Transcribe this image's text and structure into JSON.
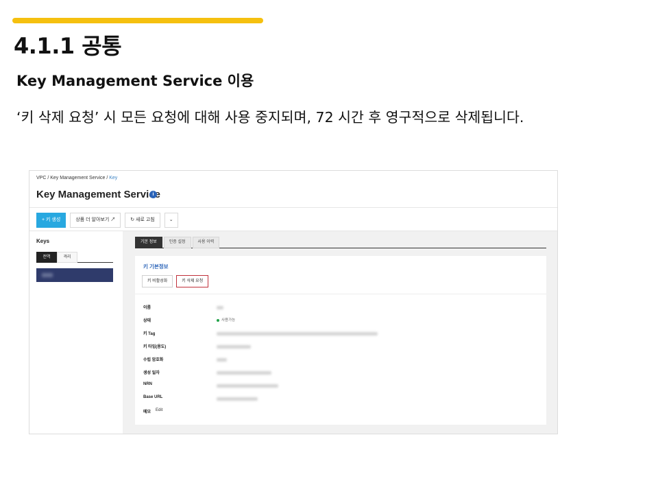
{
  "slide": {
    "title": "4.1.1 공통",
    "subtitle": "Key Management Service 이용",
    "description": "‘키 삭제 요청’ 시 모든 요청에 대해 사용 중지되며, 72 시간 후 영구적으로 삭제됩니다.",
    "accent_color": "#f5c00f"
  },
  "console": {
    "breadcrumb": {
      "root": "VPC",
      "service": "Key Management Service",
      "current": "Key"
    },
    "service_title": "Key Management Service",
    "info_icon": "info-icon",
    "toolbar": {
      "create_label": "+ 키 생성",
      "learn_more_label": "상품 더 알아보기 ↗",
      "refresh_label": "↻ 새로 고침",
      "more_icon": "chevron-down-icon",
      "more_glyph": "⌄"
    },
    "sidebar": {
      "title": "Keys",
      "tabs": [
        "전역",
        "격리"
      ],
      "active_tab": "전역"
    },
    "tabs": [
      "기본 정보",
      "인증 설정",
      "사용 이력"
    ],
    "active_tab": "기본 정보",
    "card": {
      "title": "키 기본정보",
      "disable_label": "키 비활성화",
      "delete_request_label": "키 삭제 요청",
      "highlight_color": "#c0303a",
      "rows": [
        {
          "label": "이름"
        },
        {
          "label": "상태",
          "status": "사용가능"
        },
        {
          "label": "키 Tag"
        },
        {
          "label": "키 타입(용도)"
        },
        {
          "label": "수립 암호화"
        },
        {
          "label": "생성 일자"
        },
        {
          "label": "NRN"
        },
        {
          "label": "Base URL"
        },
        {
          "label": "메모",
          "edit": "Edit"
        }
      ]
    }
  }
}
